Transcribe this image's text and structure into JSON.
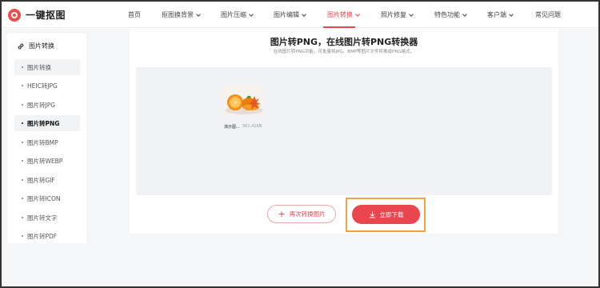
{
  "brand": {
    "name": "一键抠图",
    "color": "#e8454e"
  },
  "nav": {
    "items": [
      {
        "label": "首页",
        "dropdown": false,
        "active": false
      },
      {
        "label": "抠图换背景",
        "dropdown": true,
        "active": false
      },
      {
        "label": "图片压缩",
        "dropdown": true,
        "active": false
      },
      {
        "label": "图片编辑",
        "dropdown": true,
        "active": false
      },
      {
        "label": "图片转换",
        "dropdown": true,
        "active": true
      },
      {
        "label": "照片修复",
        "dropdown": true,
        "active": false
      },
      {
        "label": "特色功能",
        "dropdown": true,
        "active": false
      },
      {
        "label": "客户端",
        "dropdown": true,
        "active": false
      },
      {
        "label": "常见问题",
        "dropdown": false,
        "active": false
      }
    ]
  },
  "sidebar": {
    "header": "图片转换",
    "icon": "link-icon",
    "items": [
      {
        "label": "图片转换",
        "state": "hover"
      },
      {
        "label": "HEIC转JPG",
        "state": ""
      },
      {
        "label": "图片转JPG",
        "state": ""
      },
      {
        "label": "图片转PNG",
        "state": "current"
      },
      {
        "label": "图片转BMP",
        "state": ""
      },
      {
        "label": "图片转WEBP",
        "state": ""
      },
      {
        "label": "图片转GIF",
        "state": ""
      },
      {
        "label": "图片转ICON",
        "state": ""
      },
      {
        "label": "图片转文字",
        "state": ""
      },
      {
        "label": "图片转PDF",
        "state": ""
      }
    ]
  },
  "main": {
    "title": "图片转PNG，在线图片转PNG转换器",
    "subtitle": "在线图片转PNG功能，可批量将JPG、BMP等图片文件转换成PNG格式。",
    "file": {
      "name": "演示图...",
      "size": "561.41KB",
      "icon": "orange-photo-thumbnail"
    },
    "reconvert_label": "再次转换图片",
    "download_label": "立即下载",
    "highlight_color": "#f4a04a"
  }
}
